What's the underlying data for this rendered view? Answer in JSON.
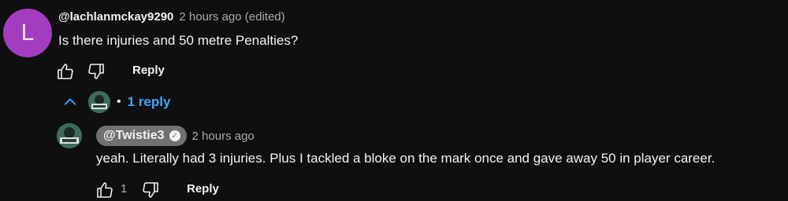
{
  "comment": {
    "avatar_letter": "L",
    "author": "@lachlanmckay9290",
    "timestamp": "2 hours ago (edited)",
    "text": "Is there injuries and 50 metre Penalties?",
    "reply_label": "Reply",
    "icons": [
      "thumb-up-icon",
      "thumb-down-icon"
    ]
  },
  "replies_toggle": {
    "separator": "•",
    "label": "1 reply",
    "icon": "chevron-up-icon"
  },
  "reply": {
    "author": "@Twistie3",
    "verified_icon": "verified-check-icon",
    "timestamp": "2 hours ago",
    "text": "yeah. Literally had 3 injuries. Plus I tackled a bloke on the mark once and gave away 50 in player career.",
    "like_count": "1",
    "reply_label": "Reply"
  },
  "colors": {
    "background": "#0f0f0f",
    "avatar_purple": "#a33dbf",
    "link_blue": "#3ea6ff",
    "pill_gray": "#717171",
    "muted_text": "#aaaaaa"
  }
}
